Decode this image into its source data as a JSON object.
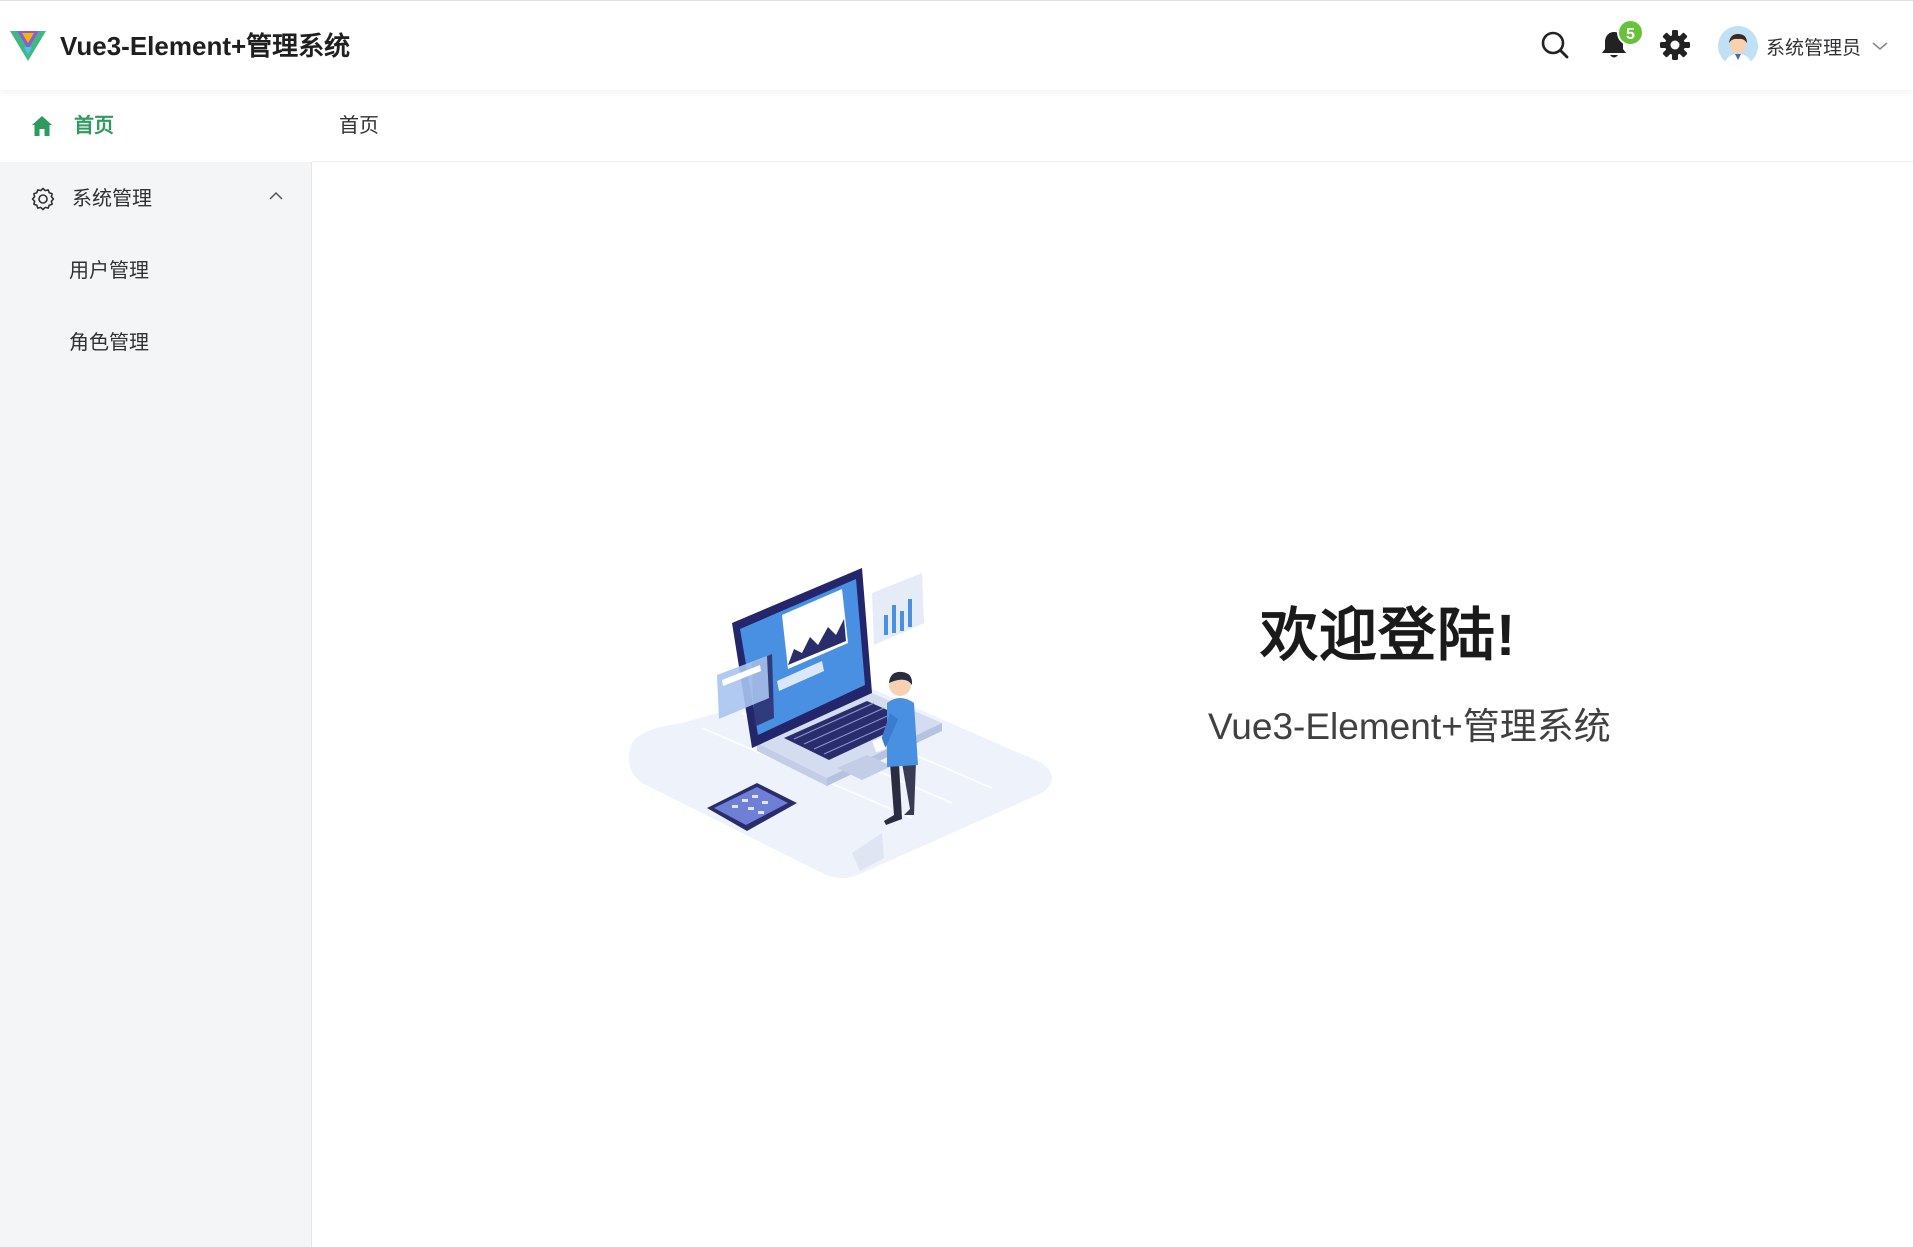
{
  "header": {
    "app_title": "Vue3-Element+管理系统",
    "notification_count": "5",
    "user_name": "系统管理员",
    "icons": [
      "logo-icon",
      "search-icon",
      "bell-icon",
      "gear-icon",
      "avatar",
      "chevron-down-icon"
    ]
  },
  "sidebar": {
    "home_label": "首页",
    "group": {
      "label": "系统管理",
      "expanded": true,
      "items": [
        {
          "label": "用户管理"
        },
        {
          "label": "角色管理"
        }
      ]
    }
  },
  "breadcrumb": {
    "current": "首页"
  },
  "main": {
    "welcome": "欢迎登陆!",
    "subtitle": "Vue3-Element+管理系统"
  },
  "colors": {
    "accent": "#2e9a5e",
    "badge": "#67c23a",
    "sidebar_bg": "#f4f5f6",
    "illustration_blue": "#4a90e2"
  }
}
